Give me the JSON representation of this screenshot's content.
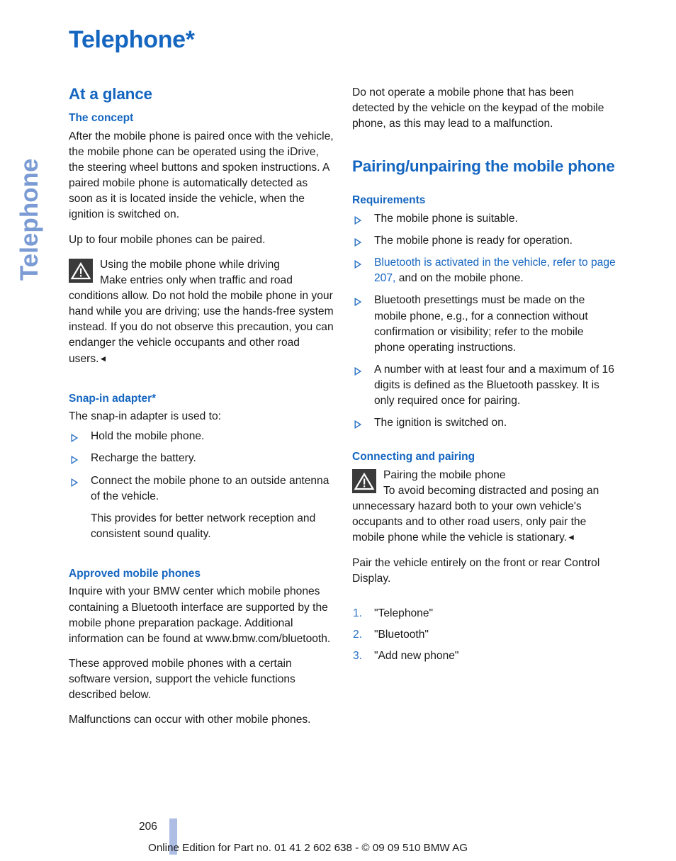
{
  "side_tab": {
    "label": "Telephone"
  },
  "page_title": "Telephone*",
  "colors": {
    "heading_blue": "#1566c0",
    "side_tab_blue": "#7b9bd4",
    "bullet_blue": "#2b72c4",
    "warning_icon_bg": "#3a3a3a",
    "footer_bar_blue": "#aebde4",
    "body_text": "#1a1a1a"
  },
  "left_column": {
    "at_a_glance": {
      "heading": "At a glance",
      "the_concept": {
        "heading": "The concept",
        "paragraph_1": "After the mobile phone is paired once with the vehicle, the mobile phone can be operated using the iDrive, the steering wheel buttons and spoken instructions. A paired mobile phone is automatically detected as soon as it is located inside the vehicle, when the ignition is switched on.",
        "paragraph_2": "Up to four mobile phones can be paired.",
        "warning": {
          "icon": "warning-triangle-icon",
          "title": "Using the mobile phone while driving",
          "body": "Make entries only when traffic and road conditions allow. Do not hold the mobile phone in your hand while you are driving; use the hands-free system instead. If you do not observe this precaution, you can endanger the vehicle occupants and other road users.",
          "end_mark": "◄"
        }
      },
      "snap_in_adapter": {
        "heading": "Snap-in adapter*",
        "intro": "The snap-in adapter is used to:",
        "items": [
          {
            "text": "Hold the mobile phone."
          },
          {
            "text": "Recharge the battery."
          },
          {
            "text": "Connect the mobile phone to an outside antenna of the vehicle.",
            "subnote": "This provides for better network reception and consistent sound quality."
          }
        ]
      },
      "approved_mobile_phones": {
        "heading": "Approved mobile phones",
        "paragraph_1": "Inquire with your BMW center which mobile phones containing a Bluetooth interface are supported by the mobile phone preparation package. Additional information can be found at www.bmw.com/bluetooth.",
        "paragraph_2": "These approved mobile phones with a certain software version, support the vehicle functions described below.",
        "paragraph_3": "Malfunctions can occur with other mobile phones."
      }
    }
  },
  "right_column": {
    "intro_paragraph": "Do not operate a mobile phone that has been detected by the vehicle on the keypad of the mobile phone, as this may lead to a malfunction.",
    "pairing": {
      "heading": "Pairing/unpairing the mobile phone",
      "requirements": {
        "heading": "Requirements",
        "items": [
          {
            "text": "The mobile phone is suitable."
          },
          {
            "text": "The mobile phone is ready for operation."
          },
          {
            "link_text": "Bluetooth is activated in the vehicle, refer to page 207,",
            "text": " and on the mobile phone."
          },
          {
            "text": "Bluetooth presettings must be made on the mobile phone, e.g., for a connection without confirmation or visibility; refer to the mobile phone operating instructions."
          },
          {
            "text": "A number with at least four and a maximum of 16 digits is defined as the Bluetooth passkey. It is only required once for pairing."
          },
          {
            "text": "The ignition is switched on."
          }
        ]
      },
      "connecting_and_pairing": {
        "heading": "Connecting and pairing",
        "warning": {
          "icon": "warning-triangle-icon",
          "title": "Pairing the mobile phone",
          "body": "To avoid becoming distracted and posing an unnecessary hazard both to your own vehicle's occupants and to other road users, only pair the mobile phone while the vehicle is stationary.",
          "end_mark": "◄"
        },
        "instruction": "Pair the vehicle entirely on the front or rear Control Display.",
        "steps": [
          {
            "num": "1.",
            "text": "\"Telephone\""
          },
          {
            "num": "2.",
            "text": "\"Bluetooth\""
          },
          {
            "num": "3.",
            "text": "\"Add new phone\""
          }
        ]
      }
    }
  },
  "footer": {
    "page_number": "206",
    "note": "Online Edition for Part no. 01 41 2 602 638 - © 09 09 510 BMW AG"
  }
}
